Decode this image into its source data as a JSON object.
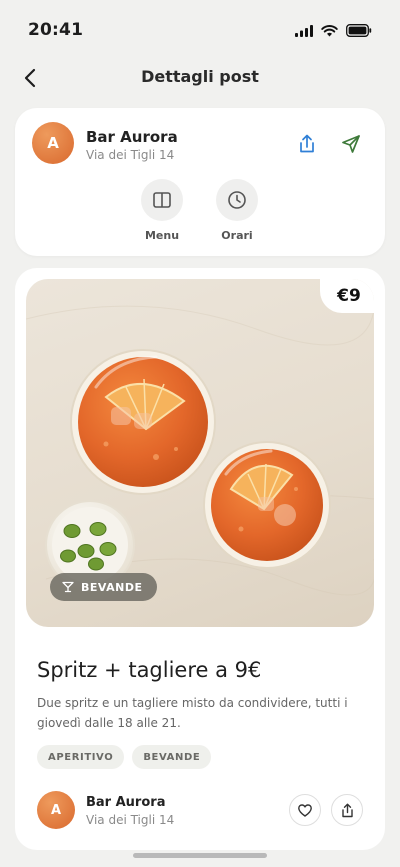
{
  "status_bar": {
    "time": "20:41"
  },
  "header": {
    "title": "Dettagli post"
  },
  "business": {
    "avatar_letter": "A",
    "name": "Bar Aurora",
    "address": "Via dei Tigli 14",
    "actions": [
      {
        "label": "Menu",
        "icon": "book-icon"
      },
      {
        "label": "Orari",
        "icon": "clock-icon"
      }
    ]
  },
  "post": {
    "price": "€9",
    "category": "BEVANDE",
    "title": "Spritz + tagliere a 9€",
    "description": "Due spritz e un tagliere misto da condividere, tutti i giovedì dalle 18 alle 21.",
    "tags": [
      "APERITIVO",
      "BEVANDE"
    ],
    "author": {
      "avatar_letter": "A",
      "name": "Bar Aurora",
      "address": "Via dei Tigli 14"
    }
  },
  "colors": {
    "accent_orange": "#e1712f",
    "share_blue": "#2f7fd6",
    "directions_green": "#3e7a3a",
    "olive_green": "#6f9a33"
  }
}
